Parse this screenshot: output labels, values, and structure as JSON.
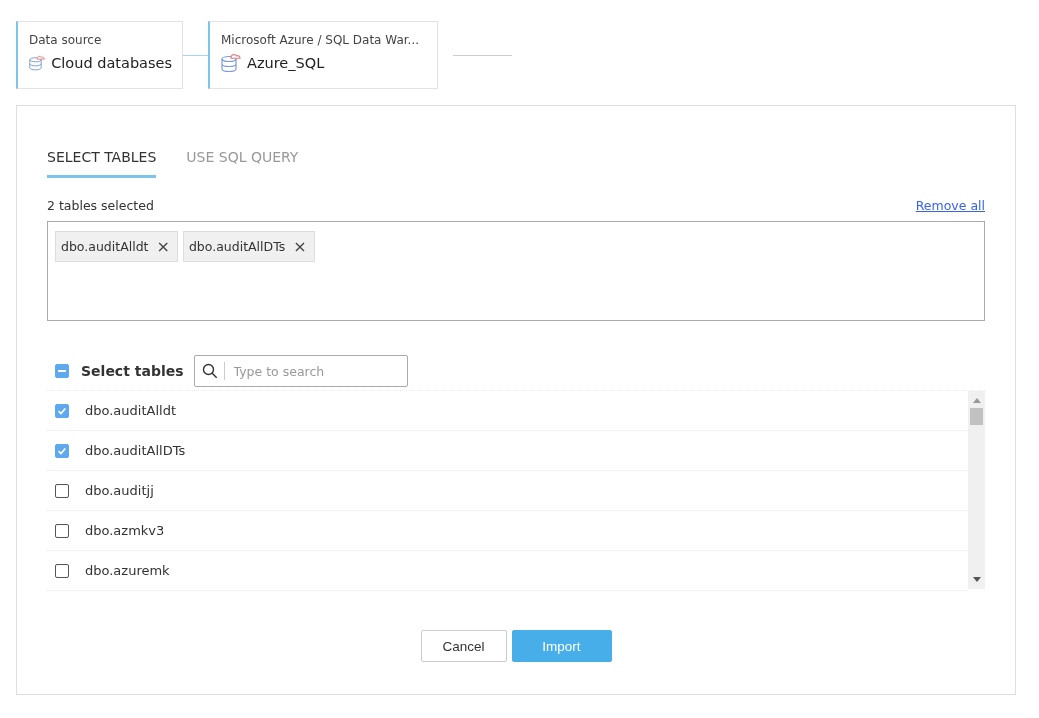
{
  "breadcrumb": [
    {
      "caption": "Data source",
      "name": "Cloud databases"
    },
    {
      "caption": "Microsoft Azure / SQL Data War...",
      "name": "Azure_SQL"
    }
  ],
  "tabs": [
    {
      "label": "SELECT TABLES",
      "selected": true
    },
    {
      "label": "USE SQL QUERY",
      "selected": false
    }
  ],
  "selection_count": "2 tables selected",
  "remove_all": "Remove all",
  "chips": [
    {
      "label": "dbo.auditAlldt",
      "remove": "×"
    },
    {
      "label": "dbo.auditAllDTs",
      "remove": "×"
    }
  ],
  "select_all": {
    "label": "Select tables",
    "partial": true
  },
  "search": {
    "placeholder": "Type to search"
  },
  "tables": [
    {
      "name": "dbo.auditAlldt",
      "checked": true
    },
    {
      "name": "dbo.auditAllDTs",
      "checked": true
    },
    {
      "name": "dbo.auditjj",
      "checked": false
    },
    {
      "name": "dbo.azmkv3",
      "checked": false
    },
    {
      "name": "dbo.azuremk",
      "checked": false
    }
  ],
  "buttons": [
    {
      "label": "Cancel",
      "kind": "secondary"
    },
    {
      "label": "Import",
      "kind": "primary"
    }
  ]
}
